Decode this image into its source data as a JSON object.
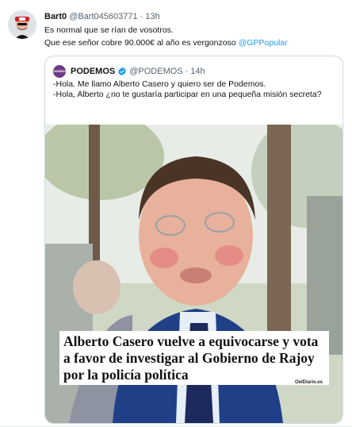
{
  "tweet": {
    "display_name": "Bart0",
    "handle": "@Bart045603771",
    "separator": "·",
    "time": "13h",
    "line1": "Es normal que se rían de vosotros.",
    "line2_prefix": "Que ese señor cobre 90.000€ al año es vergonzoso ",
    "mention": "@GPPopular"
  },
  "quoted": {
    "avatar_label": "PODEMOS",
    "display_name": "PODEMOS",
    "handle": "@PODEMOS",
    "separator": "·",
    "time": "14h",
    "line1": "-Hola. Me llamo Alberto Casero y quiero ser de Podemos.",
    "line2": "-Hola, Alberto ¿no te gustaría participar en una pequeña misión secreta?",
    "headline": "Alberto Casero vuelve a equivocarse y vota a favor de investigar al Gobierno de Rajoy por la policía política",
    "source_logo": "OelDiario.es"
  },
  "colors": {
    "link": "#1d9bf0",
    "verified": "#1d9bf0",
    "podemos": "#6e3a86",
    "secondary_text": "#536471"
  },
  "icons": {
    "verified": "verified-badge-icon"
  }
}
